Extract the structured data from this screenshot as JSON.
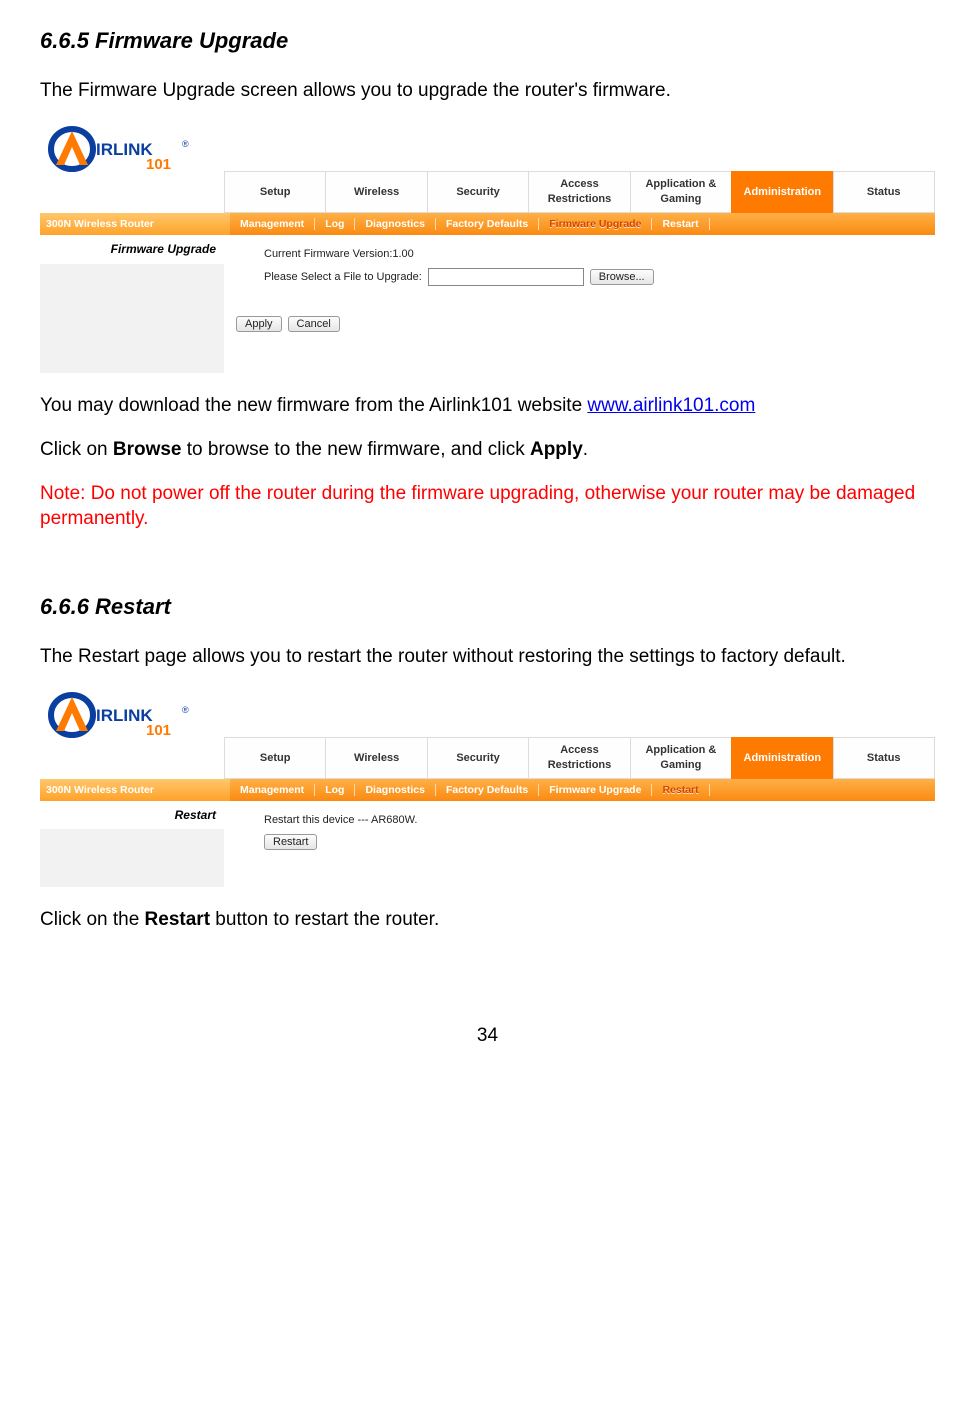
{
  "sec1": {
    "heading": "6.6.5 Firmware Upgrade",
    "intro": "The Firmware Upgrade screen allows you to upgrade the router's firmware.",
    "p_download_pre": "You may download the new firmware from the Airlink101 website ",
    "link_text": "www.airlink101.com",
    "p_browse_pre": "Click on ",
    "p_browse_b1": "Browse",
    "p_browse_mid": " to browse to the new firmware, and click ",
    "p_browse_b2": "Apply",
    "p_browse_end": ".",
    "note": "Note: Do not power off the router during the firmware upgrading, otherwise your router may be damaged permanently."
  },
  "sec2": {
    "heading": "6.6.6 Restart",
    "intro": "The Restart page allows you to restart the router without restoring the settings to factory default.",
    "p_click_pre": "Click on the ",
    "p_click_b": "Restart",
    "p_click_end": " button to restart the router."
  },
  "router": {
    "model": "300N Wireless Router",
    "tabs": [
      "Setup",
      "Wireless",
      "Security",
      "Access Restrictions",
      "Application & Gaming",
      "Administration",
      "Status"
    ],
    "subnav": [
      "Management",
      "Log",
      "Diagnostics",
      "Factory Defaults",
      "Firmware Upgrade",
      "Restart"
    ]
  },
  "shot1": {
    "side_title": "Firmware Upgrade",
    "ver_label": "Current Firmware Version:",
    "ver_value": "1.00",
    "file_label": "Please Select a File to Upgrade:",
    "browse_btn": "Browse...",
    "apply_btn": "Apply",
    "cancel_btn": "Cancel",
    "active_sub": "Firmware Upgrade"
  },
  "shot2": {
    "side_title": "Restart",
    "restart_text": "Restart this device --- AR680W.",
    "restart_btn": "Restart",
    "active_sub": "Restart"
  },
  "page_number": "34"
}
